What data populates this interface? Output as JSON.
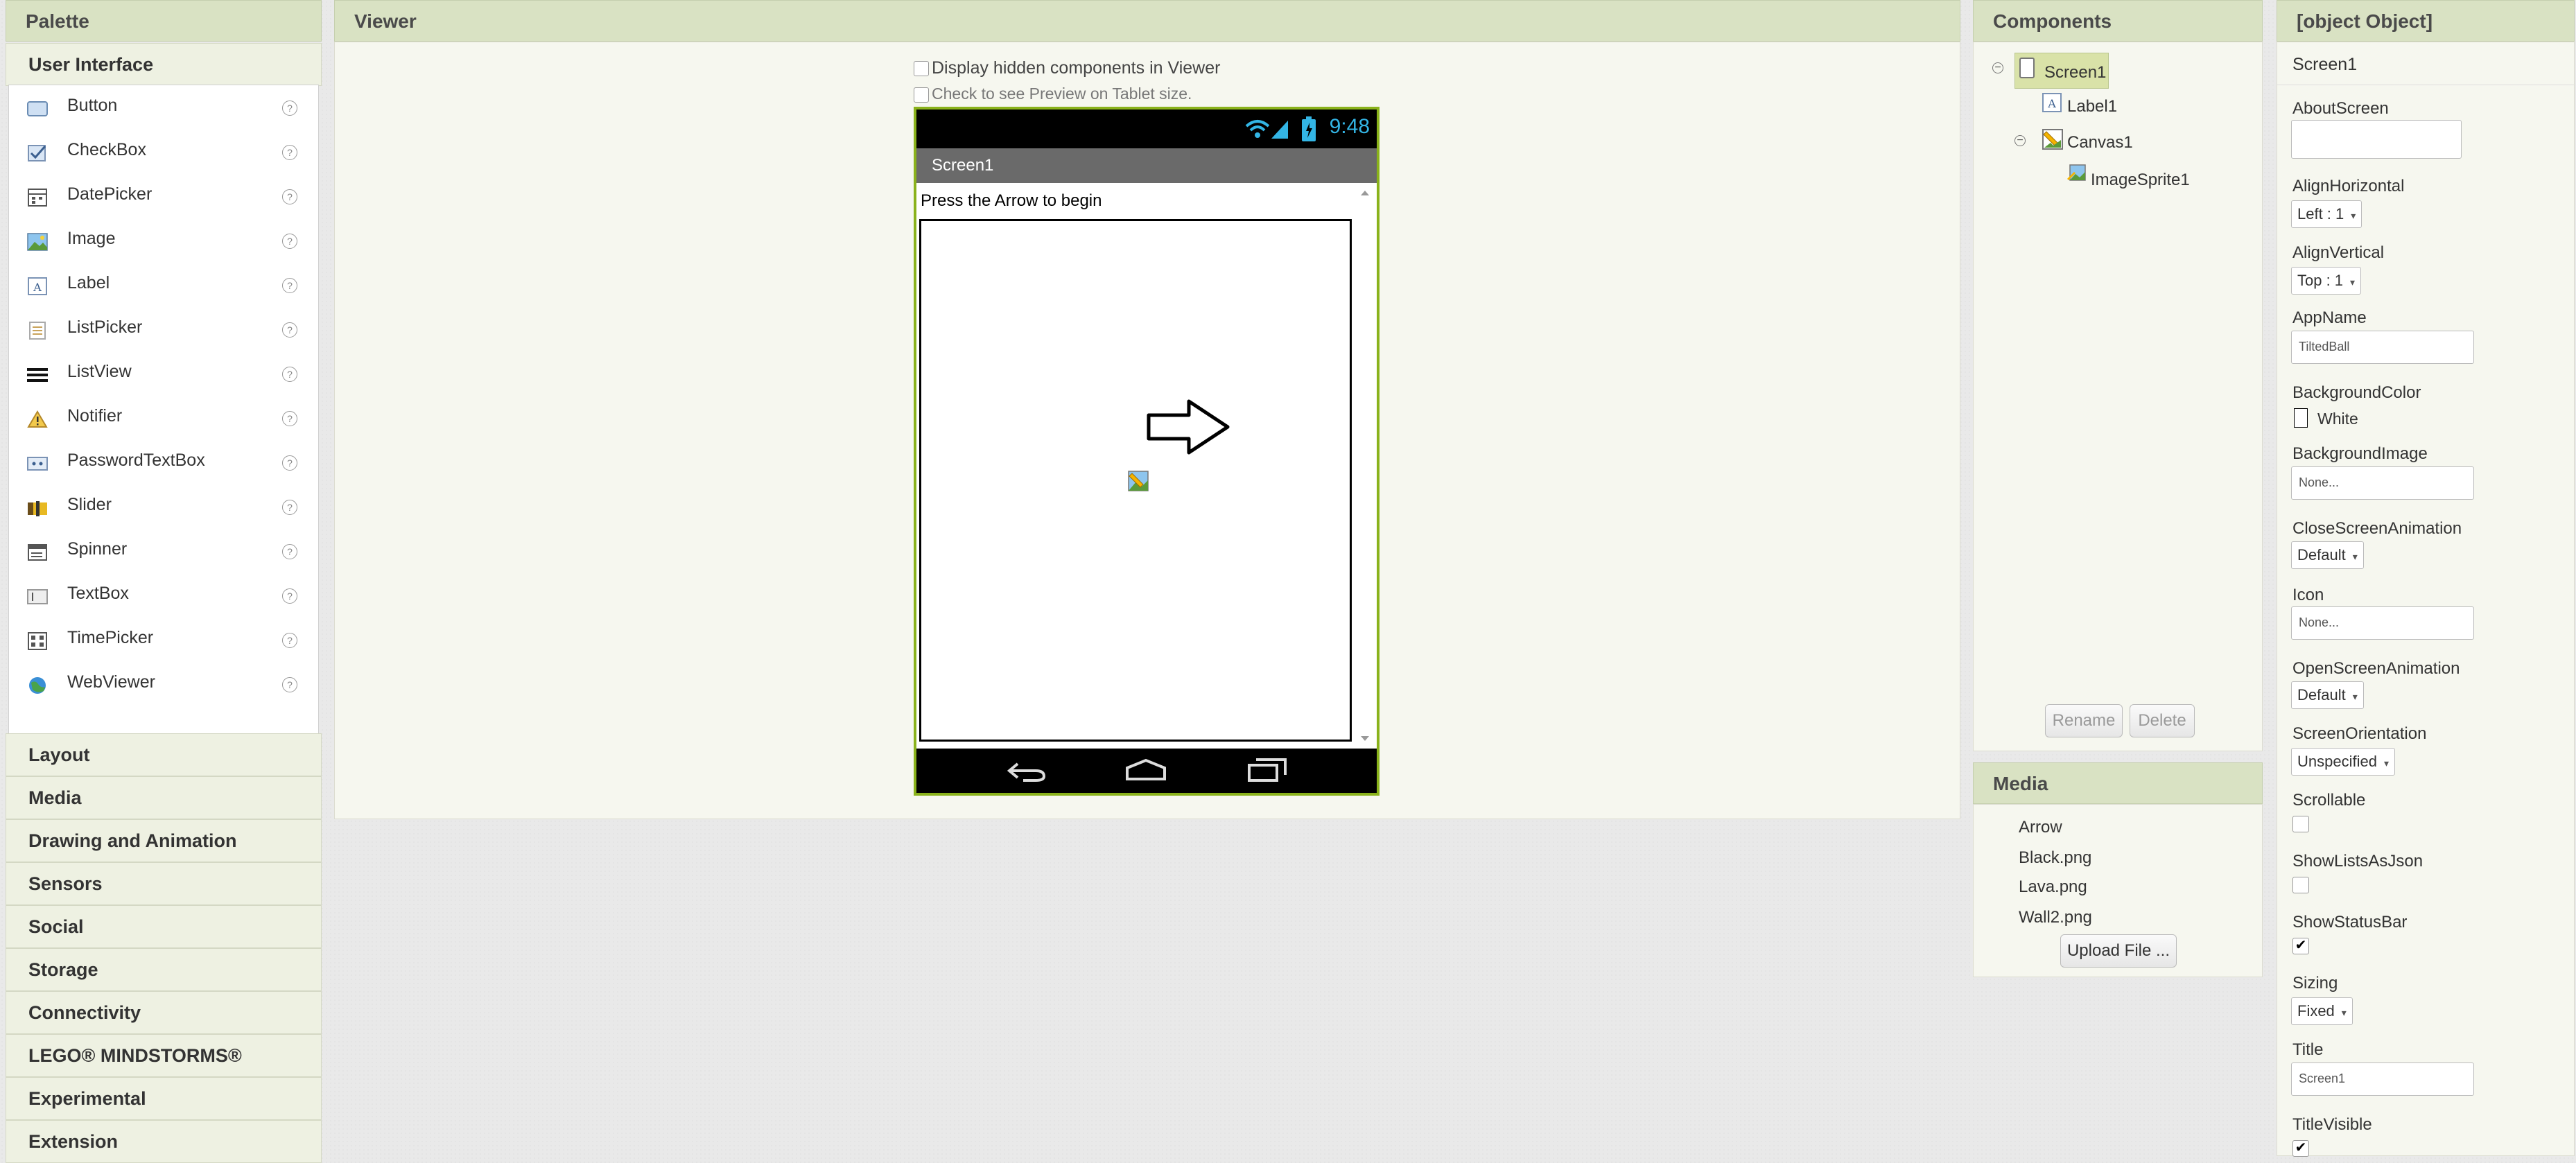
{
  "palette": {
    "title": "Palette",
    "open_category": "User Interface",
    "items": [
      {
        "label": "Button",
        "icon": "button-icon"
      },
      {
        "label": "CheckBox",
        "icon": "checkbox-icon"
      },
      {
        "label": "DatePicker",
        "icon": "datepicker-icon"
      },
      {
        "label": "Image",
        "icon": "image-icon"
      },
      {
        "label": "Label",
        "icon": "label-icon"
      },
      {
        "label": "ListPicker",
        "icon": "listpicker-icon"
      },
      {
        "label": "ListView",
        "icon": "listview-icon"
      },
      {
        "label": "Notifier",
        "icon": "notifier-icon"
      },
      {
        "label": "PasswordTextBox",
        "icon": "passwordtextbox-icon"
      },
      {
        "label": "Slider",
        "icon": "slider-icon"
      },
      {
        "label": "Spinner",
        "icon": "spinner-icon"
      },
      {
        "label": "TextBox",
        "icon": "textbox-icon"
      },
      {
        "label": "TimePicker",
        "icon": "timepicker-icon"
      },
      {
        "label": "WebViewer",
        "icon": "webviewer-icon"
      }
    ],
    "help_glyph": "?",
    "categories": [
      "Layout",
      "Media",
      "Drawing and Animation",
      "Sensors",
      "Social",
      "Storage",
      "Connectivity",
      "LEGO® MINDSTORMS®",
      "Experimental",
      "Extension"
    ]
  },
  "viewer": {
    "title": "Viewer",
    "show_hidden_label": "Display hidden components in Viewer",
    "tablet_preview_label": "Check to see Preview on Tablet size.",
    "phone": {
      "clock": "9:48",
      "screen_title": "Screen1",
      "label_text": "Press the Arrow to begin"
    }
  },
  "components": {
    "title": "Components",
    "tree": {
      "screen": "Screen1",
      "label": "Label1",
      "canvas": "Canvas1",
      "sprite": "ImageSprite1"
    },
    "rename_label": "Rename",
    "delete_label": "Delete"
  },
  "media": {
    "title": "Media",
    "files": [
      "Arrow",
      "Black.png",
      "Lava.png",
      "Wall2.png"
    ],
    "upload_label": "Upload File ..."
  },
  "properties": {
    "title": {
      "label": "Title",
      "value": "Screen1"
    },
    "component": "Screen1",
    "about_screen": {
      "label": "AboutScreen",
      "value": ""
    },
    "align_horizontal": {
      "label": "AlignHorizontal",
      "value": "Left : 1"
    },
    "align_vertical": {
      "label": "AlignVertical",
      "value": "Top : 1"
    },
    "app_name": {
      "label": "AppName",
      "value": "TiltedBall"
    },
    "background_color": {
      "label": "BackgroundColor",
      "value": "White",
      "swatch": "#ffffff"
    },
    "background_image": {
      "label": "BackgroundImage",
      "value": "None..."
    },
    "close_screen_animation": {
      "label": "CloseScreenAnimation",
      "value": "Default"
    },
    "icon": {
      "label": "Icon",
      "value": "None..."
    },
    "open_screen_animation": {
      "label": "OpenScreenAnimation",
      "value": "Default"
    },
    "screen_orientation": {
      "label": "ScreenOrientation",
      "value": "Unspecified"
    },
    "scrollable": {
      "label": "Scrollable",
      "checked": false
    },
    "show_lists_as_json": {
      "label": "ShowListsAsJson",
      "checked": false
    },
    "show_status_bar": {
      "label": "ShowStatusBar",
      "checked": true
    },
    "sizing": {
      "label": "Sizing",
      "value": "Fixed"
    },
    "title_visible": {
      "label": "TitleVisible",
      "checked": true
    }
  },
  "colors": {
    "header_bg": "#d9e2c3",
    "selection": "#d9e2a8",
    "phone_border": "#8ab21b",
    "clock": "#33b5e5"
  }
}
